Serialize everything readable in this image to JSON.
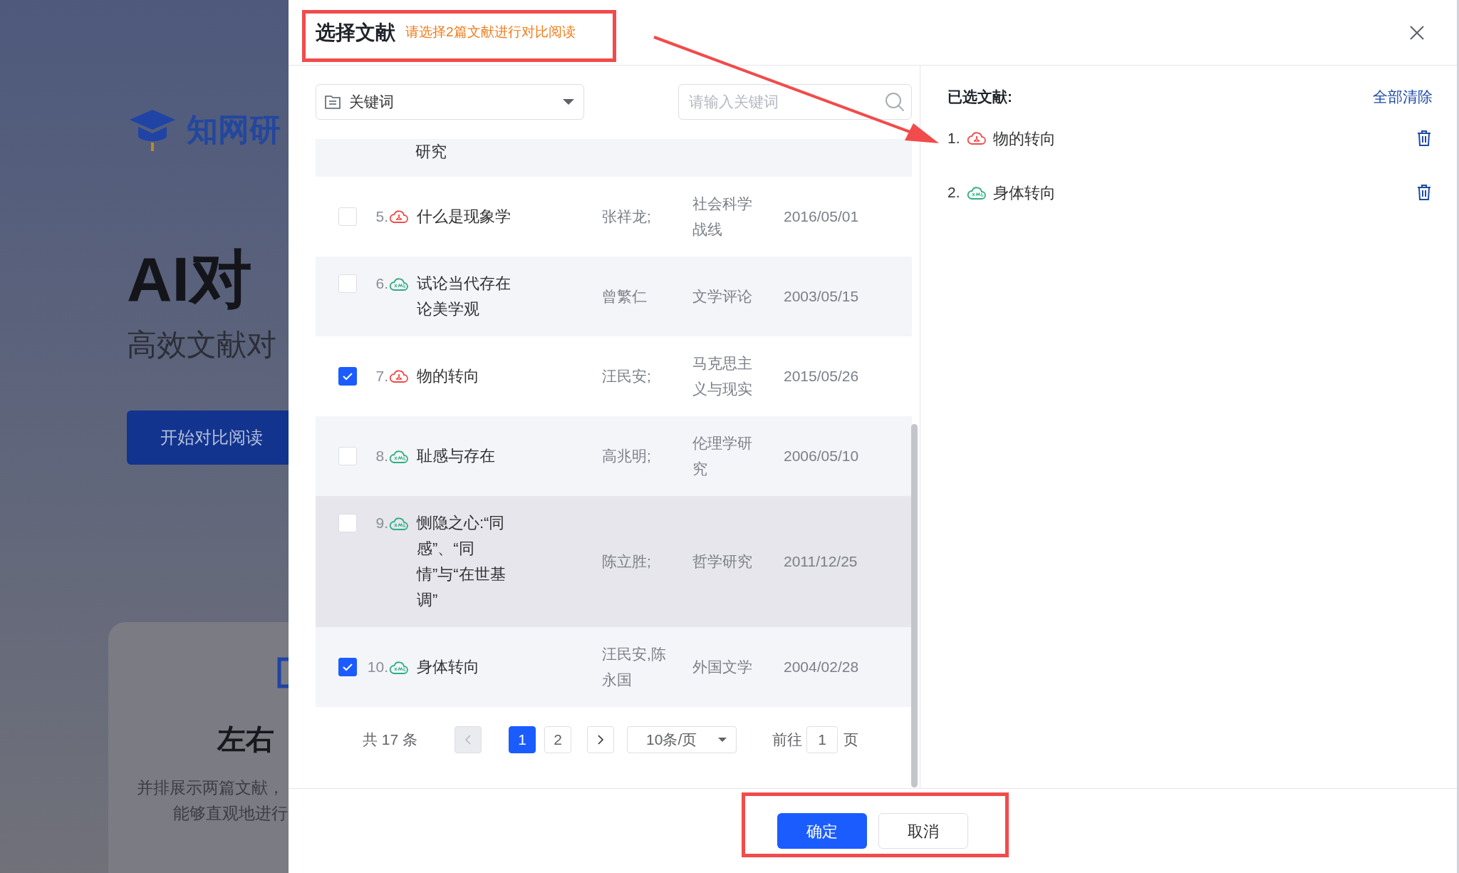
{
  "background_page": {
    "logo_text": "知网研",
    "hero_title": "AI对",
    "hero_subtitle": "高效文献对",
    "start_button": "开始对比阅读",
    "feature_card": {
      "title": "左右",
      "lines": [
        "并排展示两篇文献，",
        "能够直观地进行"
      ]
    }
  },
  "dialog": {
    "title": "选择文献",
    "hint": "请选择2篇文献进行对比阅读",
    "filter_select": {
      "value": "关键词"
    },
    "search": {
      "placeholder": "请输入关键词"
    },
    "partial_row": {
      "title": "研究"
    },
    "rows": [
      {
        "number": "5.",
        "kind": "pdf",
        "title": "什么是现象学",
        "author": "张祥龙;",
        "journal": "社会科学战线",
        "date": "2016/05/01",
        "checked": false,
        "hovered": false
      },
      {
        "number": "6.",
        "kind": "xml",
        "title": "试论当代存在论美学观",
        "author": "曾繁仁",
        "journal": "文学评论",
        "date": "2003/05/15",
        "checked": false,
        "hovered": false
      },
      {
        "number": "7.",
        "kind": "pdf",
        "title": "物的转向",
        "author": "汪民安;",
        "journal": "马克思主义与现实",
        "date": "2015/05/26",
        "checked": true,
        "hovered": false
      },
      {
        "number": "8.",
        "kind": "xml",
        "title": "耻感与存在",
        "author": "高兆明;",
        "journal": "伦理学研究",
        "date": "2006/05/10",
        "checked": false,
        "hovered": false
      },
      {
        "number": "9.",
        "kind": "xml",
        "title": "恻隐之心:“同感”、“同情”与“在世基调”",
        "author": "陈立胜;",
        "journal": "哲学研究",
        "date": "2011/12/25",
        "checked": false,
        "hovered": true
      },
      {
        "number": "10.",
        "kind": "xml",
        "title": "身体转向",
        "author": "汪民安,陈永国",
        "journal": "外国文学",
        "date": "2004/02/28",
        "checked": true,
        "hovered": false
      }
    ],
    "pagination": {
      "total": "共 17 条",
      "prev_disabled": true,
      "pages": [
        {
          "label": "1",
          "selected": true
        },
        {
          "label": "2",
          "selected": false
        }
      ],
      "page_size": "10条/页",
      "goto_label": "前往",
      "goto_value": "1",
      "goto_suffix": "页"
    },
    "selected_panel": {
      "title": "已选文献:",
      "clear_all": "全部清除",
      "items": [
        {
          "number": "1.",
          "kind": "pdf",
          "title": "物的转向"
        },
        {
          "number": "2.",
          "kind": "xml",
          "title": "身体转向"
        }
      ]
    },
    "buttons": {
      "confirm": "确定",
      "cancel": "取消"
    }
  }
}
